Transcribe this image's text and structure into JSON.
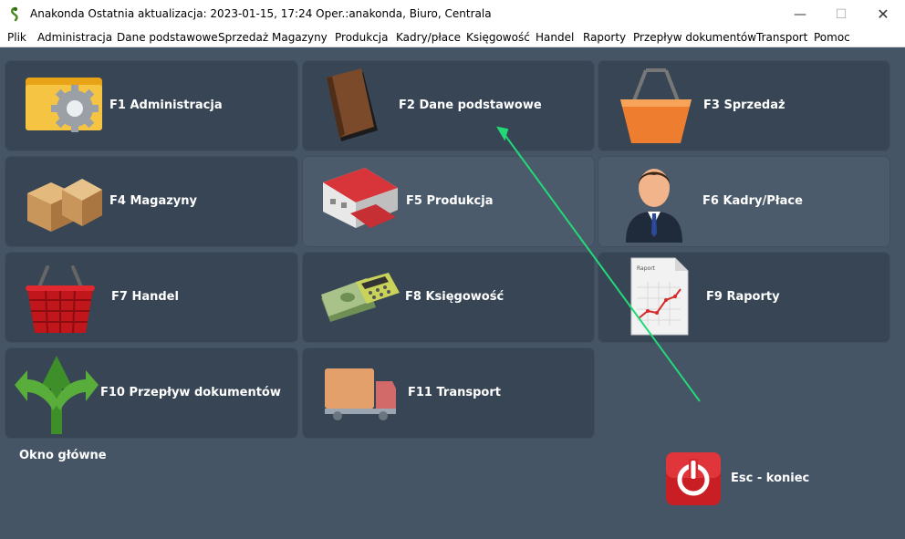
{
  "window": {
    "title": "Anakonda Ostatnia aktualizacja: 2023-01-15, 17:24 Oper.:anakonda, Biuro, Centrala",
    "minimize": "—",
    "maximize": "☐",
    "close": "✕"
  },
  "menu": [
    "Plik",
    "Administracja",
    "Dane podstawowe",
    "Sprzedaż",
    "Magazyny",
    "Produkcja",
    "Kadry/płace",
    "Księgowość",
    "Handel",
    "Raporty",
    "Przepływ dokumentów",
    "Transport",
    "Pomoc"
  ],
  "tiles": {
    "f1": "F1 Administracja",
    "f2": "F2 Dane podstawowe",
    "f3": "F3 Sprzedaż",
    "f4": "F4 Magazyny",
    "f5": "F5 Produkcja",
    "f6": "F6 Kadry/Płace",
    "f7": "F7 Handel",
    "f8": "F8 Księgowość",
    "f9": "F9 Raporty",
    "f10": "F10 Przepływ dokumentów",
    "f11": "F11 Transport"
  },
  "report_icon_text": "Raport",
  "status_label": "Okno główne",
  "exit_label": "Esc - koniec",
  "colors": {
    "background": "#465566",
    "tile": "#374555",
    "tile_highlight": "#4c5b6b",
    "annotation_arrow": "#22d877"
  }
}
